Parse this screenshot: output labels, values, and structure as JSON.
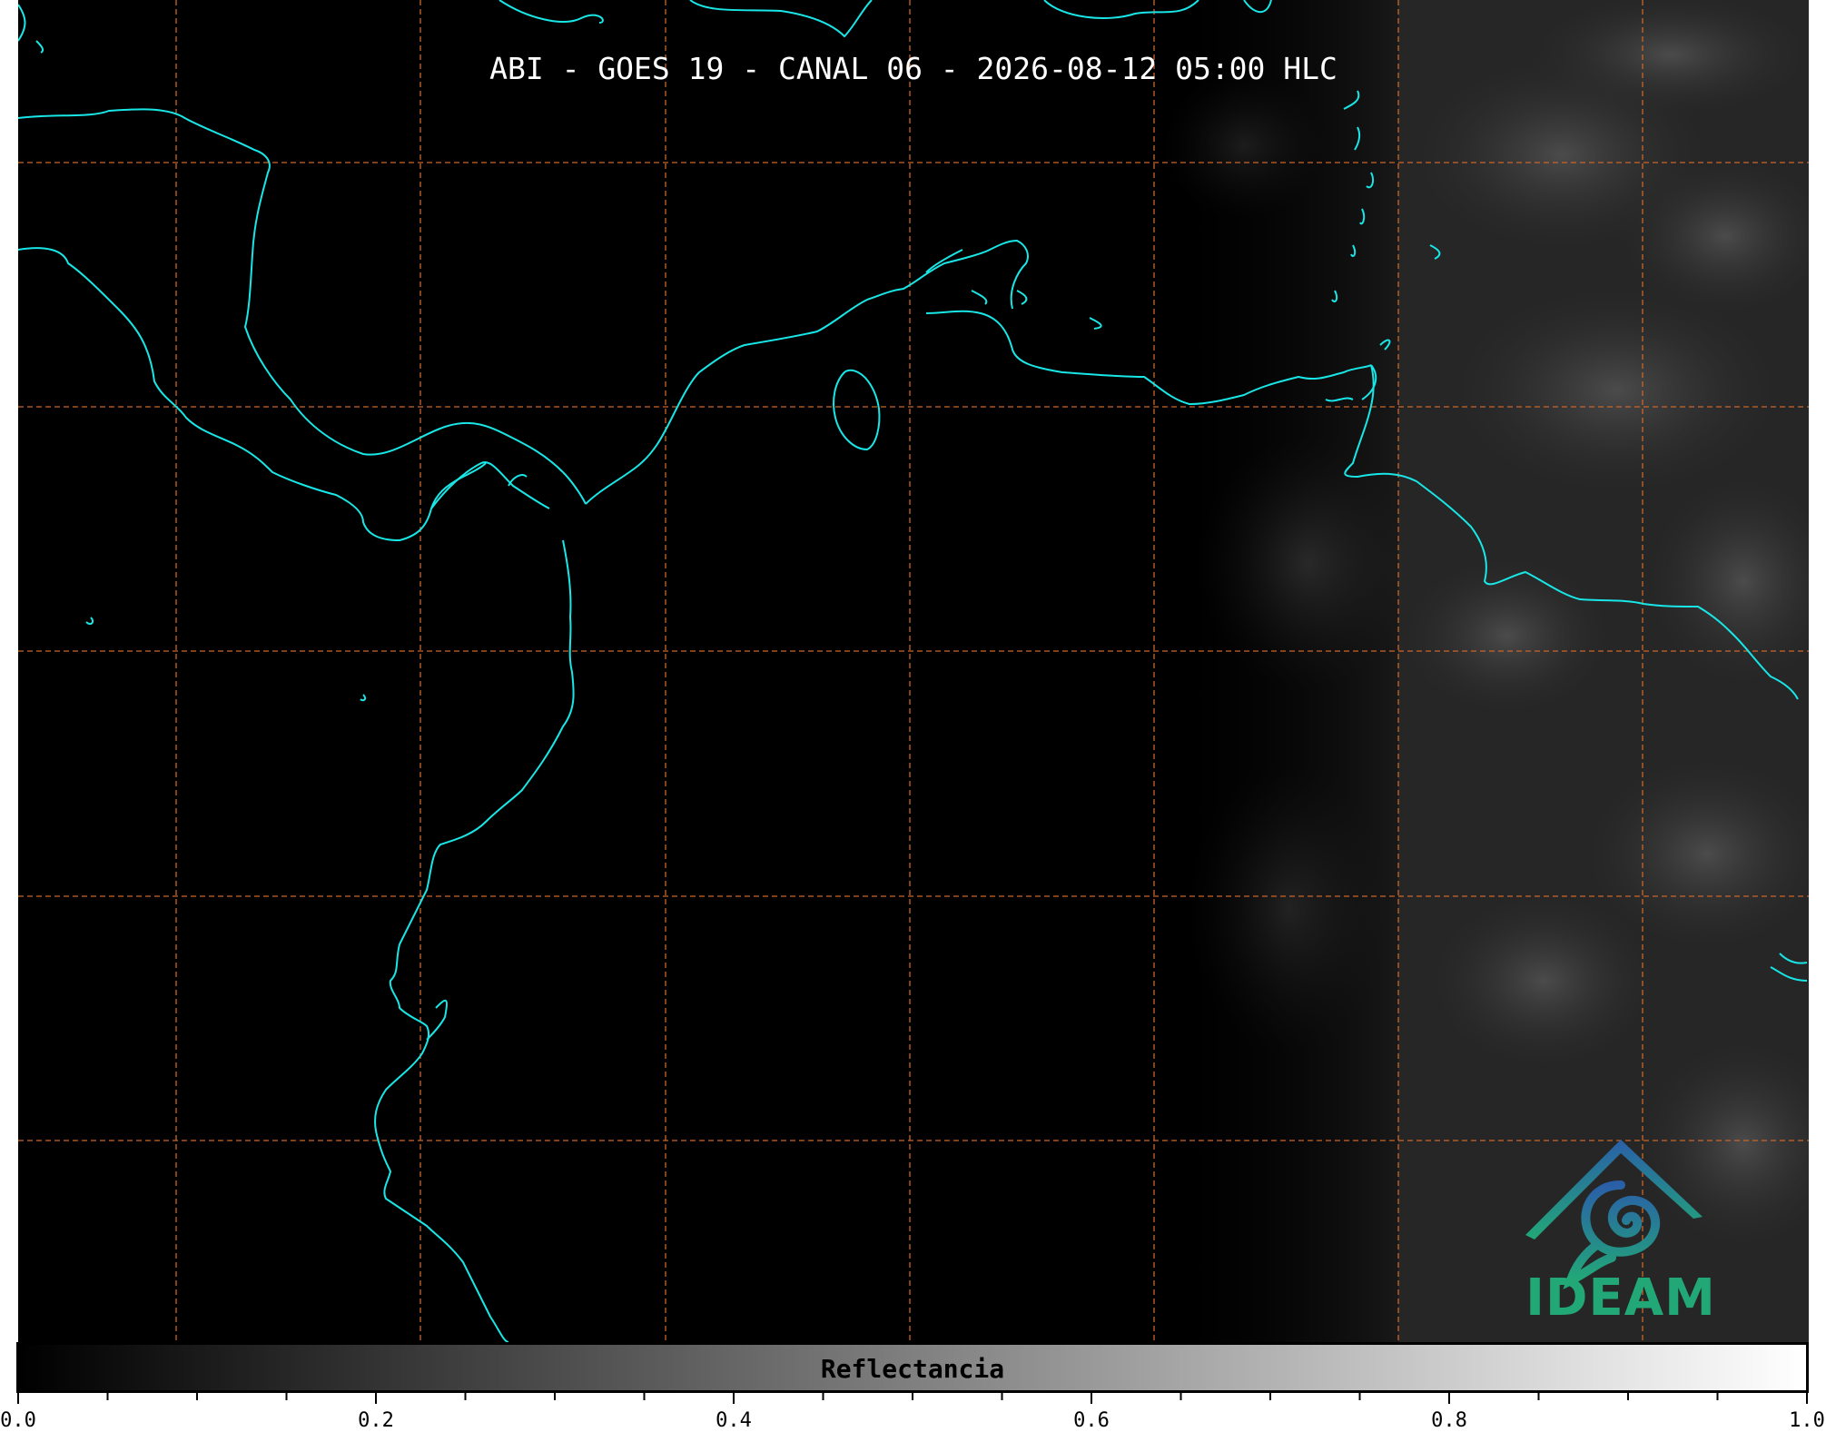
{
  "map": {
    "title": "ABI - GOES 19 - CANAL 06 - 2026-08-12 05:00 HLC",
    "colors": {
      "background": "#000000",
      "coastline": "#19e6e6",
      "gridline": "#c8662a",
      "cloud_dark": "#1a1a1a",
      "cloud_light": "#5a5a5a"
    },
    "logo": {
      "text": "IDEAM",
      "icon": "ideam-mountain-swirl-icon",
      "color_top": "#2a5fa8",
      "color_bottom": "#22a877"
    }
  },
  "colorbar": {
    "label": "Reflectancia",
    "min": 0.0,
    "max": 1.0,
    "tick_labels": [
      "0.0",
      "0.2",
      "0.4",
      "0.6",
      "0.8",
      "1.0"
    ],
    "tick_values": [
      0.0,
      0.2,
      0.4,
      0.6,
      0.8,
      1.0
    ],
    "minor_step": 0.05,
    "gradient": [
      "#000000",
      "#ffffff"
    ]
  }
}
